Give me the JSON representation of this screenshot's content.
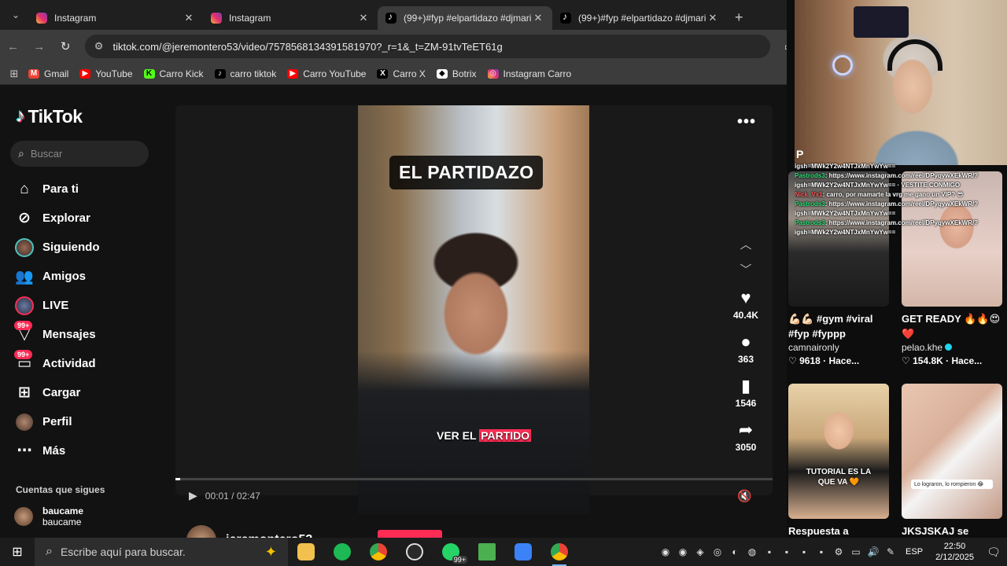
{
  "browser": {
    "tabs": [
      {
        "title": "Instagram",
        "favicon": "instagram-icon",
        "active": false
      },
      {
        "title": "Instagram",
        "favicon": "instagram-icon",
        "active": false
      },
      {
        "title": "(99+)#fyp #elpartidazo #djmari",
        "favicon": "tiktok-icon",
        "active": true
      },
      {
        "title": "(99+)#fyp #elpartidazo #djmari",
        "favicon": "tiktok-icon",
        "active": false
      }
    ],
    "url": "tiktok.com/@jeremontero53/video/7578568134391581970?_r=1&_t=ZM-91tvTeET61g",
    "bookmarks": [
      {
        "label": "Gmail",
        "icon": "gmail-icon",
        "color": "#ea4335"
      },
      {
        "label": "YouTube",
        "icon": "youtube-icon",
        "color": "#ff0000"
      },
      {
        "label": "Carro Kick",
        "icon": "kick-icon",
        "color": "#53fc18"
      },
      {
        "label": "carro tiktok",
        "icon": "tiktok-icon",
        "color": "#000000"
      },
      {
        "label": "Carro YouTube",
        "icon": "youtube-icon",
        "color": "#ff0000"
      },
      {
        "label": "Carro X",
        "icon": "x-icon",
        "color": "#000000"
      },
      {
        "label": "Botrix",
        "icon": "botrix-icon",
        "color": "#ffffff"
      },
      {
        "label": "Instagram Carro",
        "icon": "instagram-icon",
        "color": "#e1306c"
      }
    ]
  },
  "tiktok": {
    "brand": "TikTok",
    "search_placeholder": "Buscar",
    "menu": [
      {
        "label": "Para ti",
        "icon": "home-icon"
      },
      {
        "label": "Explorar",
        "icon": "compass-icon"
      },
      {
        "label": "Siguiendo",
        "icon": "following-avatar-icon"
      },
      {
        "label": "Amigos",
        "icon": "friends-icon"
      },
      {
        "label": "LIVE",
        "icon": "live-avatar-icon"
      },
      {
        "label": "Mensajes",
        "icon": "messages-icon",
        "badge": "99+"
      },
      {
        "label": "Actividad",
        "icon": "activity-icon",
        "badge": "99+"
      },
      {
        "label": "Cargar",
        "icon": "upload-icon"
      },
      {
        "label": "Perfil",
        "icon": "profile-avatar-icon"
      },
      {
        "label": "Más",
        "icon": "more-icon"
      }
    ],
    "following_header": "Cuentas que sigues",
    "following_account": {
      "username": "baucame",
      "nickname": "baucame"
    },
    "video": {
      "title_overlay": "EL PARTIDAZO",
      "caption_overlay_prefix": "VER EL ",
      "caption_overlay_highlight": "PARTIDO",
      "time": "00:01 / 02:47",
      "progress": 0.008
    },
    "actions": {
      "likes": "40.4K",
      "comments": "363",
      "saves": "1546",
      "shares": "3050"
    },
    "creator": {
      "username": "jeremontero53"
    }
  },
  "overlay": {
    "cam_letter": "P",
    "chat": [
      {
        "user": "",
        "text": "igsh=MWk2Y2w4NTJxMnYwYw=="
      },
      {
        "user": "Pastrods3",
        "text": ": https://www.instagram.com/reel/DPyqywXEkWR/?"
      },
      {
        "user": "",
        "text": "igsh=MWk2Y2w4NTJxMnYwYw== · VESTITE CONMIGO"
      },
      {
        "user": "Nick_Vx1",
        "text": ": carro, por mamarte la vrg me gano un VIP? 😎"
      },
      {
        "user": "Pastrods3",
        "text": ": https://www.instagram.com/reel/DPyqywXEkWR/?"
      },
      {
        "user": "",
        "text": "igsh=MWk2Y2w4NTJxMnYwYw=="
      },
      {
        "user": "Pastrods3",
        "text": ": https://www.instagram.com/reel/DPyqywXEkWR/?"
      },
      {
        "user": "",
        "text": "igsh=MWk2Y2w4NTJxMnYwYw=="
      }
    ],
    "cards": [
      {
        "caption": "💪🏻💪🏻 #gym #viral #fyp #fyppp",
        "user": "camnaironly",
        "likes": "9618",
        "time": "Hace...",
        "verified": false
      },
      {
        "caption": "GET READY 🔥🔥😍❤️",
        "user": "pelao.khe",
        "likes": "154.8K",
        "time": "Hace...",
        "verified": true
      },
      {
        "caption": "Respuesta a",
        "thumb_text": "TUTORIAL ES LA QUE VA 🧡"
      },
      {
        "caption": "JKSJSKAJ se",
        "thumb_text": "Lo lograron, lo rompieron 😂"
      }
    ]
  },
  "taskbar": {
    "search_placeholder": "Escribe aquí para buscar.",
    "whatsapp_badge": "99+",
    "language": "ESP",
    "time": "22:50",
    "date": "2/12/2025"
  },
  "colors": {
    "accent": "#fe2c55",
    "tiktok_cyan": "#25f4ee",
    "verified": "#20d5ec"
  }
}
